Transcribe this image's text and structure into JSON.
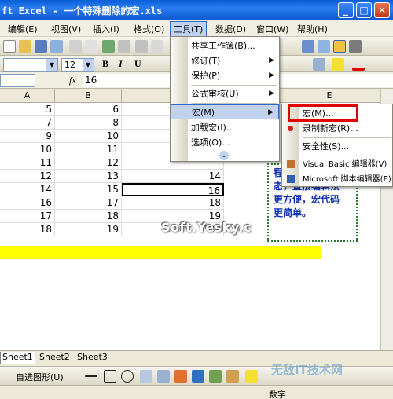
{
  "window": {
    "title": "ft Excel - 一个特殊删除的宏.xls"
  },
  "menubar": [
    {
      "label": "编辑(E)"
    },
    {
      "label": "视图(V)"
    },
    {
      "label": "插入(I)"
    },
    {
      "label": "格式(O)"
    },
    {
      "label": "工具(T)"
    },
    {
      "label": "数据(D)"
    },
    {
      "label": "窗口(W)"
    },
    {
      "label": "帮助(H)"
    }
  ],
  "format_toolbar": {
    "font_size": "12",
    "bold": "B",
    "italic": "I",
    "underline": "U"
  },
  "formula_bar": {
    "fx": "fx",
    "value": "16"
  },
  "columns": [
    "A",
    "B",
    "C",
    "D",
    "E"
  ],
  "rows": [
    [
      "5",
      "6",
      ""
    ],
    [
      "7",
      "8",
      ""
    ],
    [
      "9",
      "10",
      ""
    ],
    [
      "10",
      "11",
      ""
    ],
    [
      "11",
      "12",
      ""
    ],
    [
      "12",
      "13",
      "14"
    ],
    [
      "14",
      "15",
      "16"
    ],
    [
      "16",
      "17",
      "18"
    ],
    [
      "17",
      "18",
      "19"
    ],
    [
      "18",
      "19",
      "20"
    ]
  ],
  "note_text": [
    "程",
    "态，直接编辑法",
    "更方便，宏代码",
    "更简单。"
  ],
  "tools_menu": {
    "items": [
      {
        "label": "共享工作簿(B)...",
        "sub": ""
      },
      {
        "label": "修订(T)",
        "sub": "▶"
      },
      {
        "label": "保护(P)",
        "sub": "▶"
      },
      {
        "label": "公式审核(U)",
        "sub": "▶"
      },
      {
        "label": "宏(M)",
        "sub": "▶"
      },
      {
        "label": "加载宏(I)...",
        "sub": ""
      },
      {
        "label": "选项(O)...",
        "sub": ""
      }
    ],
    "expand": "⌄"
  },
  "macro_menu": {
    "items": [
      {
        "label": "宏(M)..."
      },
      {
        "label": "录制新宏(R)..."
      },
      {
        "label": "安全性(S)..."
      },
      {
        "label": "Visual Basic 编辑器(V)"
      },
      {
        "label": "Microsoft 脚本编辑器(E)"
      }
    ]
  },
  "sheets": [
    "Sheet1",
    "Sheet2",
    "Sheet3"
  ],
  "drawbar": {
    "autoshape": "自选图形(U)"
  },
  "statusbar": {
    "mode": "数字"
  },
  "watermarks": {
    "center": "Soft.Yesky.c",
    "corner": "无敌IT技术网"
  },
  "colors": {
    "accent": "#316ac5",
    "title_bar": "#0a5fd8",
    "highlight_box": "#e00000",
    "band": "#ffff00",
    "note_text": "#1030b0"
  }
}
